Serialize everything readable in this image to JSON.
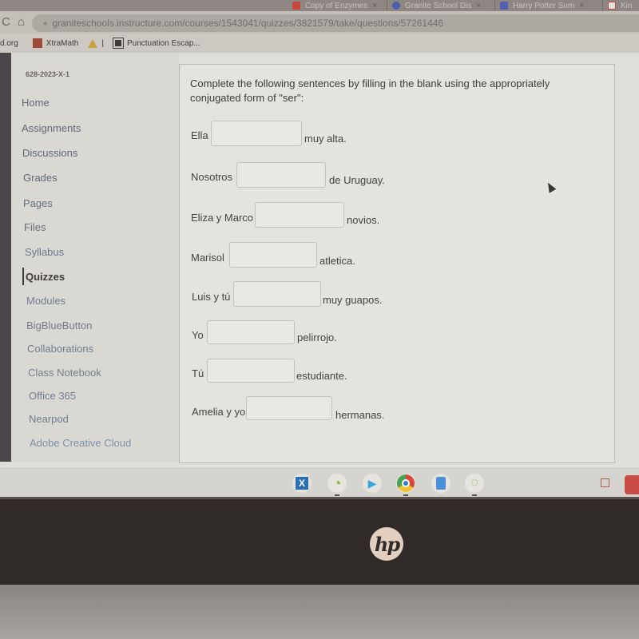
{
  "browser": {
    "tabs": [
      {
        "label": "Copy of Enzymes",
        "icon": "doc-icon",
        "color": "#c9463d"
      },
      {
        "label": "Granite School Dis",
        "icon": "school-icon",
        "color": "#4a5fb0"
      },
      {
        "label": "Harry Potter Sum",
        "icon": "docs-icon",
        "color": "#5560b5"
      },
      {
        "label": "Kin",
        "icon": "doc-icon",
        "color": "#c9463d"
      }
    ],
    "close_glyph": "×",
    "reload_glyph": "C",
    "home_glyph": "⌂",
    "lock_glyph": "🔒",
    "url": "graniteschools.instructure.com/courses/1543041/quizzes/3821579/take/questions/57261446",
    "bookmarks": [
      {
        "label": "d.org"
      },
      {
        "label": "XtraMath"
      },
      {
        "label": "|"
      },
      {
        "label": "Punctuation Escap..."
      }
    ]
  },
  "course_nav": {
    "course_code": "628-2023-X-1",
    "items": [
      {
        "label": "Home",
        "active": false
      },
      {
        "label": "Assignments",
        "active": false
      },
      {
        "label": "Discussions",
        "active": false
      },
      {
        "label": "Grades",
        "active": false
      },
      {
        "label": "Pages",
        "active": false
      },
      {
        "label": "Files",
        "active": false
      },
      {
        "label": "Syllabus",
        "active": false
      },
      {
        "label": "Quizzes",
        "active": true
      },
      {
        "label": "Modules",
        "active": false
      },
      {
        "label": "BigBlueButton",
        "active": false
      },
      {
        "label": "Collaborations",
        "active": false
      },
      {
        "label": "Class Notebook",
        "active": false
      },
      {
        "label": "Office 365",
        "active": false
      },
      {
        "label": "Nearpod",
        "active": false
      },
      {
        "label": "Adobe Creative Cloud",
        "active": false
      }
    ]
  },
  "question": {
    "instructions": "Complete the following sentences by filling in the blank using the appropriately conjugated form of \"ser\":",
    "rows": [
      {
        "subject": "Ella",
        "value": "",
        "predicate": "muy alta."
      },
      {
        "subject": "Nosotros",
        "value": "",
        "predicate": "de Uruguay."
      },
      {
        "subject": "Eliza y Marco",
        "value": "",
        "predicate": "novios."
      },
      {
        "subject": "Marisol",
        "value": "",
        "predicate": "atletica."
      },
      {
        "subject": "Luis y tú",
        "value": "",
        "predicate": "muy guapos."
      },
      {
        "subject": "Yo",
        "value": "",
        "predicate": "pelirrojo."
      },
      {
        "subject": "Tú",
        "value": "",
        "predicate": "estudiante."
      },
      {
        "subject": "Amelia y yo",
        "value": "",
        "predicate": "hermanas."
      }
    ]
  },
  "shelf": {
    "apps": [
      {
        "name": "classlink-app",
        "glyph": "X",
        "color": "#2a6fb5"
      },
      {
        "name": "progress-app",
        "glyph": "◔",
        "color": "#8bb33a"
      },
      {
        "name": "play-store-app",
        "glyph": "▶",
        "color": "#3aa7d8"
      },
      {
        "name": "chrome-app",
        "glyph": "●",
        "color": "#2f7fd6"
      },
      {
        "name": "docs-app",
        "glyph": "▤",
        "color": "#4a90d9"
      },
      {
        "name": "sync-app",
        "glyph": "◌",
        "color": "#8bb33a"
      }
    ]
  },
  "device": {
    "brand": "hp"
  }
}
